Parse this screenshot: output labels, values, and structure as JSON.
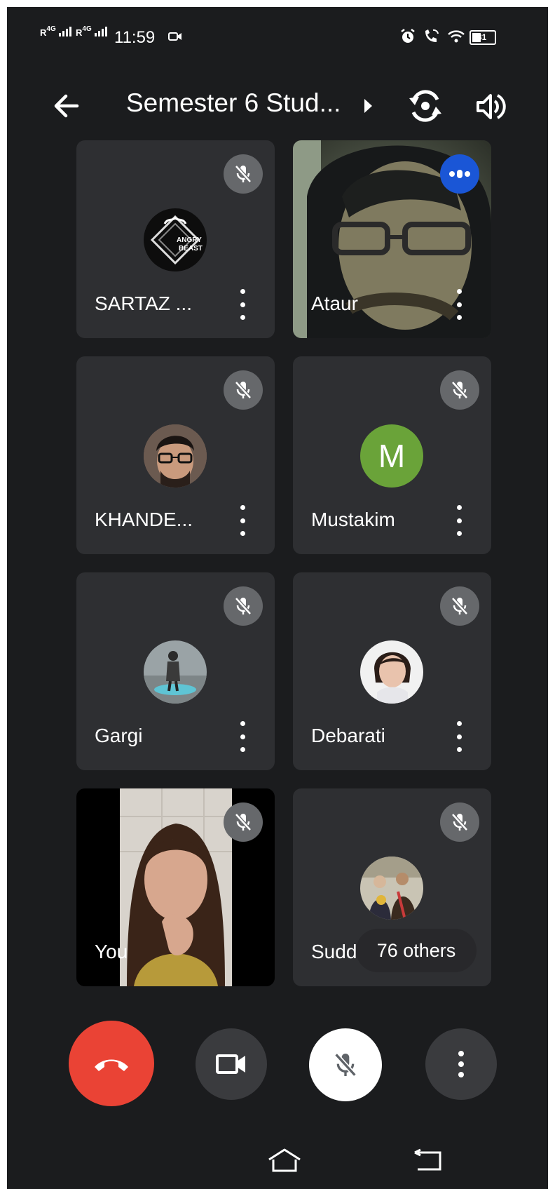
{
  "status_bar": {
    "sim1": "R",
    "sim1_net": "4G",
    "sim2": "R",
    "sim2_net": "4G",
    "time": "11:59",
    "battery": "31"
  },
  "header": {
    "title": "Semester 6 Stud..."
  },
  "participants": [
    {
      "name": "SARTAZ ...",
      "muted": true,
      "avatar_type": "logo",
      "avatar_text": "ANGRY BEAST"
    },
    {
      "name": "Ataur",
      "muted": false,
      "speaking": true,
      "avatar_type": "video"
    },
    {
      "name": "KHANDE...",
      "muted": true,
      "avatar_type": "photo"
    },
    {
      "name": "Mustakim",
      "muted": true,
      "avatar_type": "letter",
      "avatar_letter": "M",
      "avatar_color": "#6aa339"
    },
    {
      "name": "Gargi",
      "muted": true,
      "avatar_type": "photo"
    },
    {
      "name": "Debarati",
      "muted": true,
      "avatar_type": "photo"
    },
    {
      "name": "You",
      "muted": true,
      "avatar_type": "video"
    },
    {
      "name": "Sudd",
      "muted": true,
      "avatar_type": "photo",
      "others_label": "76 others"
    }
  ],
  "controls": {
    "end_call_color": "#ea4335",
    "mic_muted": true
  },
  "colors": {
    "background": "#1b1c1e",
    "tile": "#2e2f32",
    "speaking": "#1a56d6"
  }
}
